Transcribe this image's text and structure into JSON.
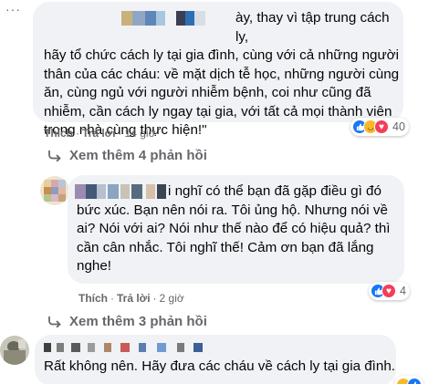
{
  "comment1": {
    "lines": [
      "ày, thay vì tập trung cách ly,",
      "hãy tổ chức cách ly tại gia đình, cùng với cả những người",
      "thân của các cháu: về mặt dịch tễ học, những người cùng",
      "ăn, cùng ngủ với người nhiễm bệnh, coi như cũng đã",
      "nhiễm, cần cách ly ngay tại gia, với tất cả mọi thành viên",
      "trong nhà cùng thực hiện!\""
    ],
    "like": "Thích",
    "reply": "Trả lời",
    "time": "14 giờ",
    "reaction_count": "40"
  },
  "more1": "Xem thêm 4 phản hồi",
  "comment2": {
    "lines": [
      "i nghĩ có thể bạn đã gặp điều gì đó",
      "bức xúc. Bạn nên nói ra. Tôi ủng hộ. Nhưng nói về",
      "ai? Nói với ai? Nói như thế nào để có hiệu quả? thì",
      "cần cân nhắc. Tôi nghĩ thế! Cảm ơn bạn đã lắng",
      "nghe!"
    ],
    "like": "Thích",
    "reply": "Trả lời",
    "time": "2 giờ",
    "reaction_count": "4"
  },
  "more2": "Xem thêm 3 phản hồi",
  "comment3": {
    "text": "Rất không nên. Hãy đưa các cháu về cách ly tại gia đình."
  },
  "colors": {
    "bubble": "#f0f2f5",
    "secondary_text": "#65676b",
    "like_blue": "#1877f2",
    "love_red": "#f33e58"
  }
}
